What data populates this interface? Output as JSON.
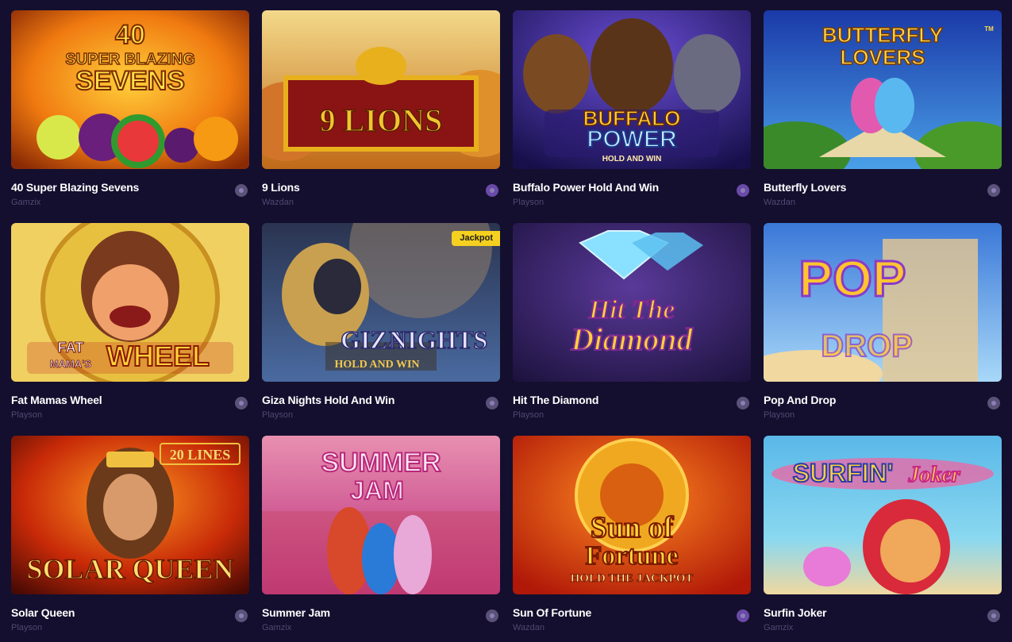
{
  "games": [
    {
      "title": "40 Super Blazing Sevens",
      "provider": "Gamzix",
      "art": [
        "40",
        "SUPER BLAZING",
        "SEVENS"
      ]
    },
    {
      "title": "9 Lions",
      "provider": "Wazdan",
      "art": [
        "9 LIONS"
      ]
    },
    {
      "title": "Buffalo Power Hold And Win",
      "provider": "Playson",
      "art": [
        "BUFFALO",
        "POWER",
        "HOLD AND WIN"
      ]
    },
    {
      "title": "Butterfly Lovers",
      "provider": "Wazdan",
      "art": [
        "BUTTERFLY",
        "LOVERS",
        "TM"
      ]
    },
    {
      "title": "Fat Mamas Wheel",
      "provider": "Playson",
      "art": [
        "FAT",
        "MAMA'S",
        "WHEEL"
      ]
    },
    {
      "title": "Giza Nights Hold And Win",
      "provider": "Playson",
      "art": [
        "GIZA",
        "NIGHTS",
        "HOLD AND WIN"
      ],
      "badge": "Jackpot"
    },
    {
      "title": "Hit The Diamond",
      "provider": "Playson",
      "art": [
        "Hit The",
        "Diamond"
      ]
    },
    {
      "title": "Pop And Drop",
      "provider": "Playson",
      "art": [
        "POP",
        "DROP"
      ]
    },
    {
      "title": "Solar Queen",
      "provider": "Playson",
      "art": [
        "20 LINES",
        "SOLAR QUEEN"
      ]
    },
    {
      "title": "Summer Jam",
      "provider": "Gamzix",
      "art": [
        "SUMMER",
        "JAM"
      ]
    },
    {
      "title": "Sun Of Fortune",
      "provider": "Wazdan",
      "art": [
        "Sun of",
        "Fortune",
        "HOLD THE JACKPOT"
      ]
    },
    {
      "title": "Surfin Joker",
      "provider": "Gamzix",
      "art": [
        "SURFIN'",
        "Joker"
      ]
    }
  ],
  "colors": {
    "background": "#140f2e",
    "title": "#ffffff",
    "provider": "#4f4a72",
    "badge": "#f5d020"
  },
  "icons": {
    "info": "info-dot-icon"
  }
}
